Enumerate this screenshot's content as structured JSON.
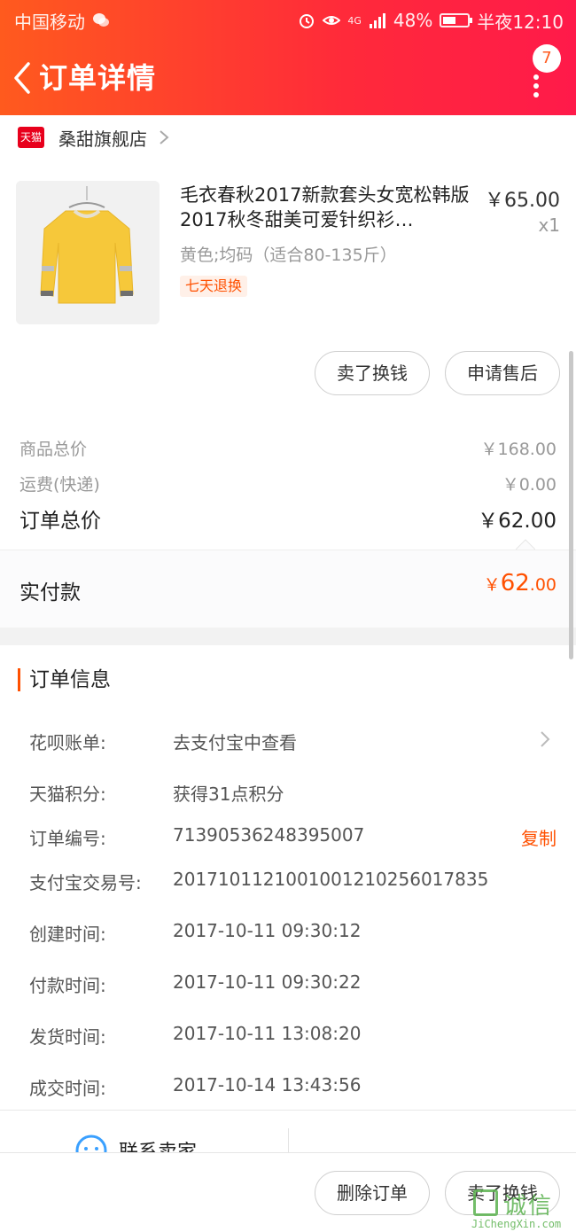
{
  "status_bar": {
    "carrier": "中国移动",
    "network": "4G",
    "battery": "48%",
    "time": "半夜12:10"
  },
  "nav": {
    "title": "订单详情",
    "badge_count": "7"
  },
  "shop": {
    "logo_text": "天猫",
    "name": "桑甜旗舰店"
  },
  "product": {
    "title": "毛衣春秋2017新款套头女宽松韩版 2017秋冬甜美可爱针织衫…",
    "price": "￥65.00",
    "quantity": "x1",
    "sku": "黄色;均码（适合80-135斤）",
    "tag": "七天退换"
  },
  "actions": {
    "sell_exchange": "卖了换钱",
    "after_sale": "申请售后",
    "delete_order": "删除订单",
    "sell_exchange_bottom": "卖了换钱",
    "contact_seller": "联系卖家"
  },
  "summary": {
    "goods_label": "商品总价",
    "goods_value": "￥168.00",
    "shipping_label": "运费(快递)",
    "shipping_value": "￥0.00",
    "total_label": "订单总价",
    "total_value": "￥62.00",
    "paid_label": "实付款",
    "paid_yen": "￥",
    "paid_int": "62",
    "paid_dec": ".00"
  },
  "order_info": {
    "title": "订单信息",
    "rows": [
      {
        "label": "花呗账单:",
        "value": "去支付宝中查看"
      },
      {
        "label": "天猫积分:",
        "value": "获得31点积分"
      },
      {
        "label": "订单编号:",
        "value": "71390536248395007",
        "action": "复制"
      },
      {
        "label": "支付宝交易号:",
        "value": "2017101121001001210256017835"
      },
      {
        "label": "创建时间:",
        "value": "2017-10-11 09:30:12"
      },
      {
        "label": "付款时间:",
        "value": "2017-10-11 09:30:22"
      },
      {
        "label": "发货时间:",
        "value": "2017-10-11 13:08:20"
      },
      {
        "label": "成交时间:",
        "value": "2017-10-14 13:43:56"
      }
    ]
  },
  "watermark": {
    "text": "诚信",
    "url": "JiChengXin.com"
  },
  "colors": {
    "accent": "#ff5000",
    "header_start": "#ff5a1e",
    "header_end": "#ff1a4a",
    "tmall_red": "#e8001c"
  },
  "icons": [
    "back-icon",
    "more-icon",
    "chevron-right-icon",
    "chat-icon",
    "alarm-icon",
    "eye-icon",
    "signal-icon",
    "battery-icon",
    "wechat-icon"
  ]
}
